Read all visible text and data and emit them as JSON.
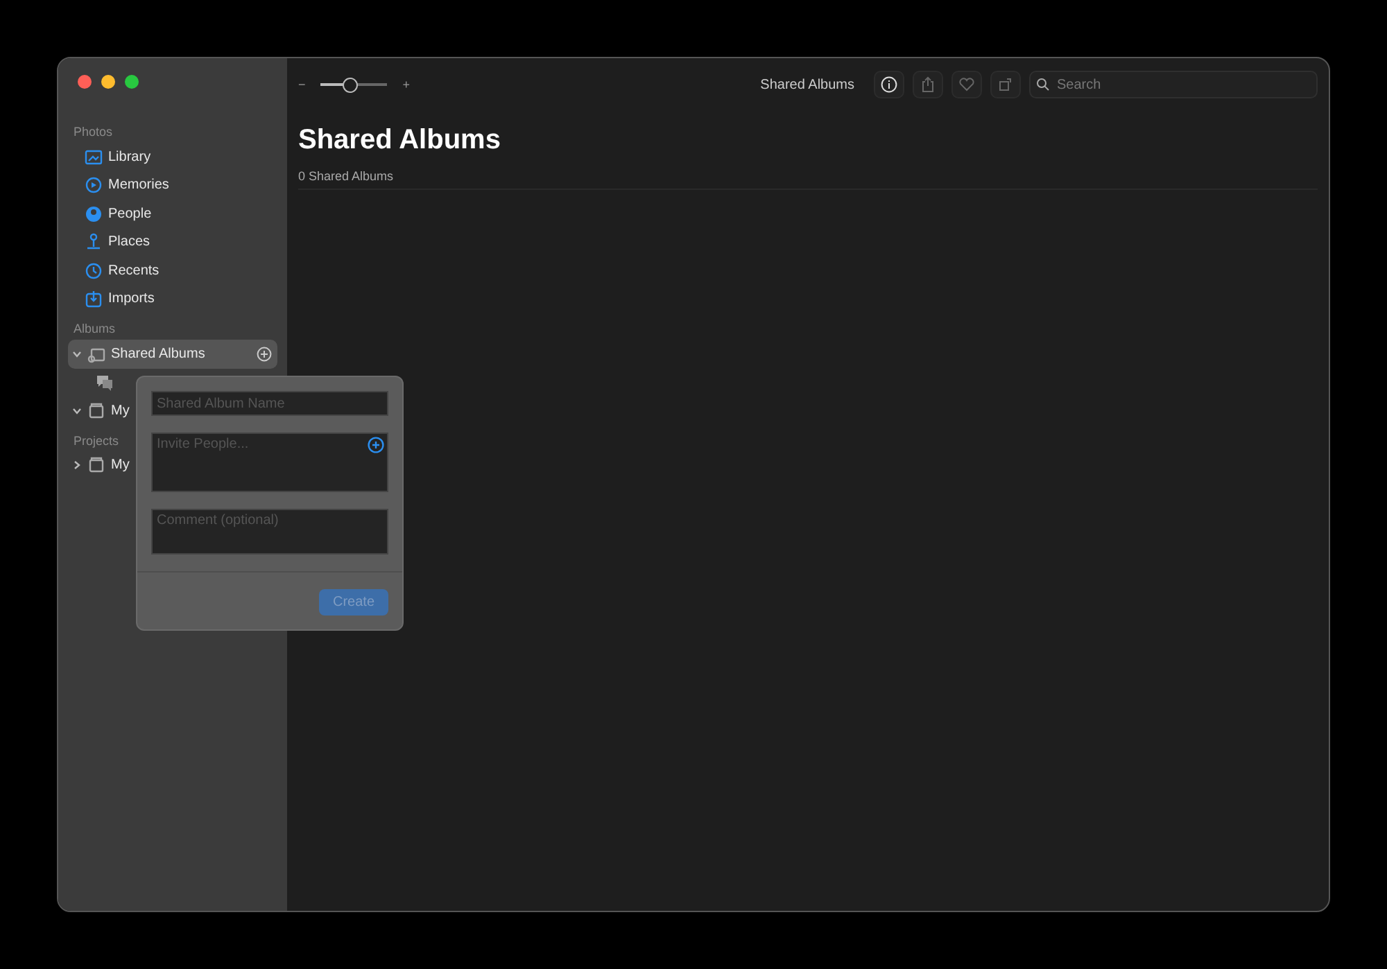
{
  "sidebar": {
    "sections": [
      {
        "title": "Photos",
        "items": [
          {
            "label": "Library",
            "selected": false
          },
          {
            "label": "Memories",
            "selected": false
          },
          {
            "label": "People",
            "selected": false
          },
          {
            "label": "Places",
            "selected": false
          },
          {
            "label": "Recents",
            "selected": false
          },
          {
            "label": "Imports",
            "selected": false
          }
        ]
      },
      {
        "title": "Albums",
        "items": [
          {
            "label": "Shared Albums",
            "selected": true,
            "expanded": true,
            "children": [
              {
                "selected": false
              }
            ]
          },
          {
            "label": "My",
            "selected": false,
            "expanded": true
          }
        ]
      },
      {
        "title": "Projects",
        "items": [
          {
            "label": "My",
            "selected": false,
            "expanded": false
          }
        ]
      }
    ]
  },
  "toolbar": {
    "zoom": {
      "minus": "−",
      "level": 0.45,
      "plus": "+"
    },
    "title": "Shared Albums",
    "search": {
      "placeholder": "Search"
    }
  },
  "content": {
    "title": "Shared Albums",
    "subtitle": "0 Shared Albums"
  },
  "popover": {
    "name": {
      "placeholder": "Shared Album Name"
    },
    "invite": {
      "placeholder": "Invite People..."
    },
    "comment": {
      "placeholder": "Comment (optional)"
    },
    "button": {
      "label": "Create",
      "disabled": true
    }
  }
}
